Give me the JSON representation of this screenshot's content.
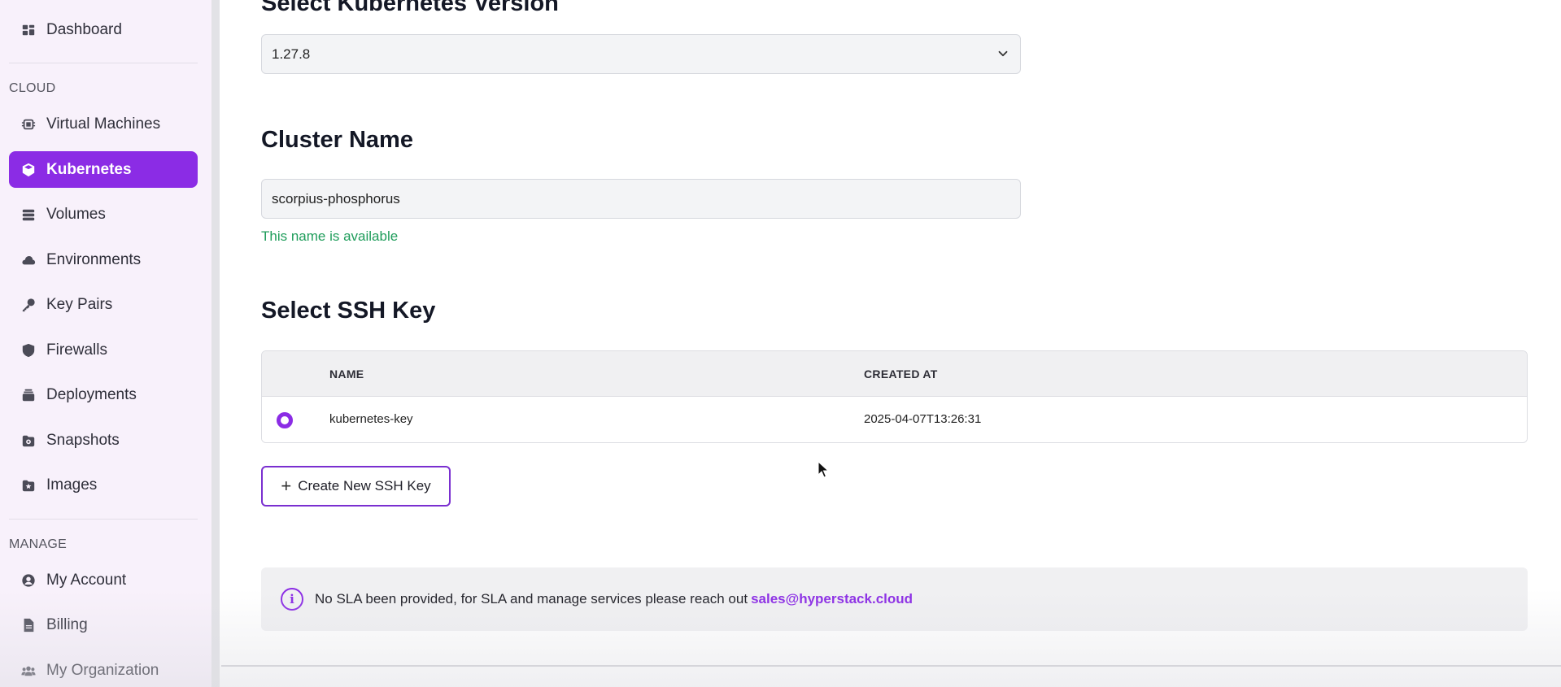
{
  "sidebar": {
    "dashboard": "Dashboard",
    "cloud_title": "CLOUD",
    "items": [
      {
        "label": "Virtual Machines",
        "icon": "chip-icon"
      },
      {
        "label": "Kubernetes",
        "icon": "cube-icon"
      },
      {
        "label": "Volumes",
        "icon": "database-icon"
      },
      {
        "label": "Environments",
        "icon": "cloud-icon"
      },
      {
        "label": "Key Pairs",
        "icon": "key-icon"
      },
      {
        "label": "Firewalls",
        "icon": "shield-icon"
      },
      {
        "label": "Deployments",
        "icon": "stack-icon"
      },
      {
        "label": "Snapshots",
        "icon": "snapshot-icon"
      },
      {
        "label": "Images",
        "icon": "image-icon"
      }
    ],
    "manage_title": "MANAGE",
    "manage_items": [
      {
        "label": "My Account",
        "icon": "user-circle-icon"
      },
      {
        "label": "Billing",
        "icon": "document-icon"
      },
      {
        "label": "My Organization",
        "icon": "users-icon"
      }
    ],
    "active": "Kubernetes"
  },
  "main": {
    "version_heading": "Select Kubernetes Version",
    "version_value": "1.27.8",
    "cluster_heading": "Cluster Name",
    "cluster_value": "scorpius-phosphorus",
    "cluster_status": "This name is available",
    "ssh_heading": "Select SSH Key",
    "table": {
      "columns": [
        "NAME",
        "CREATED AT"
      ],
      "rows": [
        {
          "name": "kubernetes-key",
          "created_at": "2025-04-07T13:26:31",
          "selected": true
        }
      ]
    },
    "create_button": "Create New SSH Key",
    "notice_text": "No SLA been provided, for SLA and manage services please reach out",
    "notice_link": "sales@hyperstack.cloud"
  },
  "colors": {
    "accent": "#8b2ce5",
    "success": "#1f9d5b"
  }
}
